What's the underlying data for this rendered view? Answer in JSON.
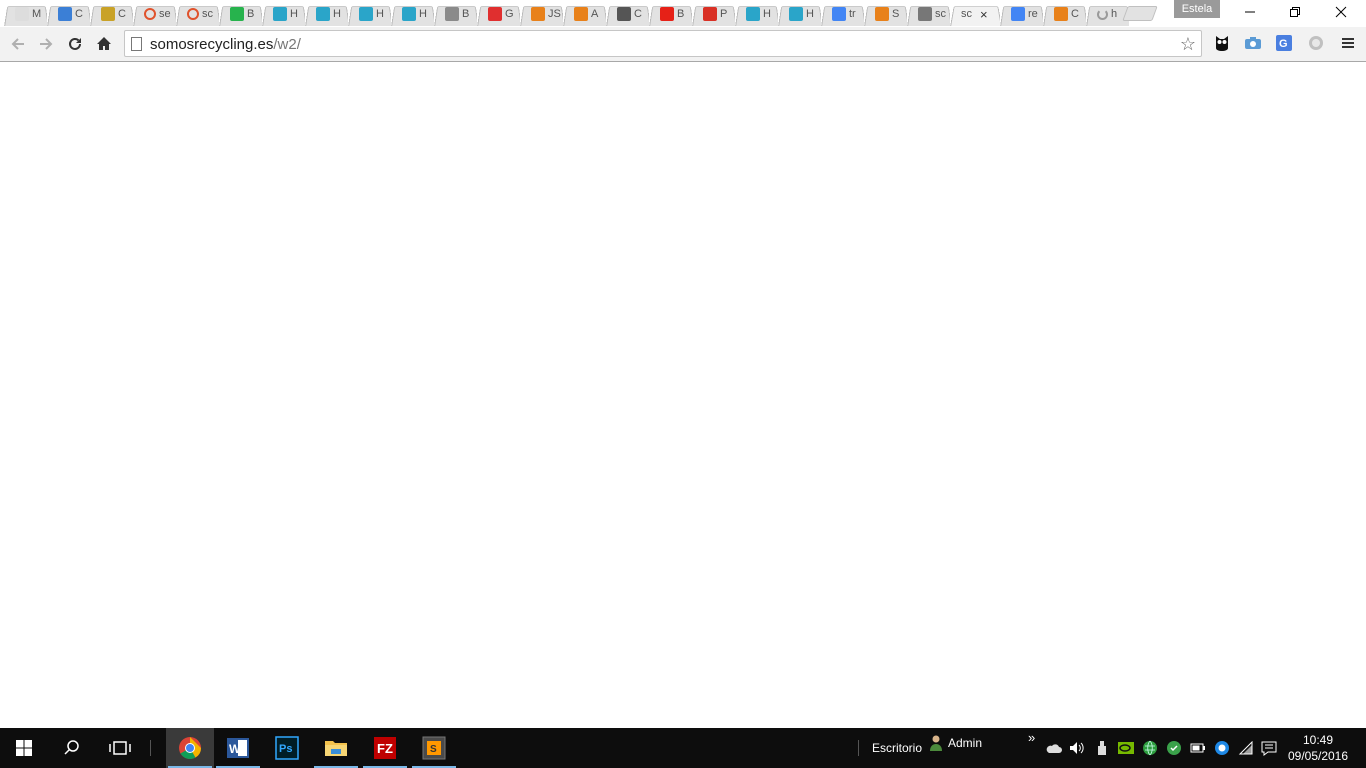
{
  "browser": {
    "tabs": [
      {
        "label": "M",
        "icon": "mail-icon",
        "color": "#dddddd",
        "muted": true
      },
      {
        "label": "C",
        "icon": "site-icon",
        "color": "#3b7fd6"
      },
      {
        "label": "C",
        "icon": "drive-folder-icon",
        "color": "#c9a227"
      },
      {
        "label": "se",
        "icon": "ring-icon",
        "color": "#e0522c"
      },
      {
        "label": "sc",
        "icon": "ring-icon",
        "color": "#e0522c"
      },
      {
        "label": "B",
        "icon": "play-icon",
        "color": "#27b34d"
      },
      {
        "label": "H",
        "icon": "snowflake-icon",
        "color": "#2aa5c9"
      },
      {
        "label": "H",
        "icon": "snowflake-icon",
        "color": "#2aa5c9"
      },
      {
        "label": "H",
        "icon": "snowflake-icon",
        "color": "#2aa5c9"
      },
      {
        "label": "H",
        "icon": "snowflake-icon",
        "color": "#2aa5c9"
      },
      {
        "label": "B",
        "icon": "flag-icon",
        "color": "#8a8a8a"
      },
      {
        "label": "G",
        "icon": "w-icon",
        "color": "#e02f2f"
      },
      {
        "label": "JS",
        "icon": "joomla-icon",
        "color": "#e8811a"
      },
      {
        "label": "A",
        "icon": "joomla-icon",
        "color": "#e8811a"
      },
      {
        "label": "C",
        "icon": "ip-icon",
        "color": "#555555"
      },
      {
        "label": "B",
        "icon": "youtube-icon",
        "color": "#e62117"
      },
      {
        "label": "P",
        "icon": "gmail-icon",
        "color": "#d93025"
      },
      {
        "label": "H",
        "icon": "snowflake-icon",
        "color": "#2aa5c9"
      },
      {
        "label": "H",
        "icon": "snowflake-icon",
        "color": "#2aa5c9"
      },
      {
        "label": "tr",
        "icon": "google-icon",
        "color": "#4285f4"
      },
      {
        "label": "S",
        "icon": "joomla-icon",
        "color": "#e8811a"
      },
      {
        "label": "sc",
        "icon": "bicycle-icon",
        "color": "#777777"
      },
      {
        "label": "sc",
        "icon": "none",
        "color": "#f2f2f2",
        "active": true
      },
      {
        "label": "re",
        "icon": "google-icon",
        "color": "#4285f4"
      },
      {
        "label": "C",
        "icon": "joomla-icon",
        "color": "#e8811a"
      },
      {
        "label": "h",
        "icon": "loading-icon",
        "color": "#9a9a9a"
      }
    ],
    "profile_name": "Estela",
    "url_host": "somosrecycling.es",
    "url_path": "/w2/"
  },
  "taskbar": {
    "apps": [
      {
        "name": "chrome",
        "icon": "chrome-icon",
        "active": true
      },
      {
        "name": "word",
        "icon": "word-icon"
      },
      {
        "name": "photoshop",
        "icon": "photoshop-icon",
        "label": "Ps"
      },
      {
        "name": "file-explorer",
        "icon": "folder-icon"
      },
      {
        "name": "filezilla",
        "icon": "filezilla-icon",
        "label": "FZ"
      },
      {
        "name": "sublime",
        "icon": "sublime-icon",
        "label": "S"
      }
    ],
    "desktop_label": "Escritorio",
    "user_label": "Admin",
    "time": "10:49",
    "date": "09/05/2016"
  }
}
